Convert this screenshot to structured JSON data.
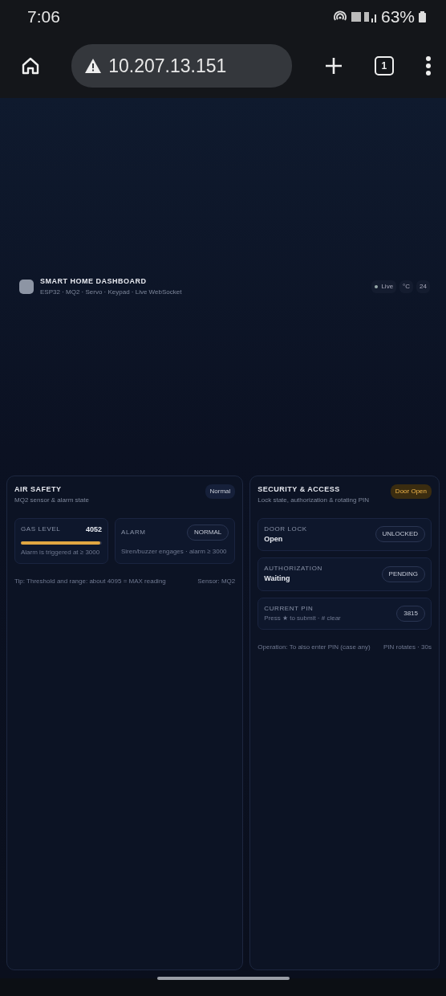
{
  "status_bar": {
    "time": "7:06",
    "battery": "63%"
  },
  "browser": {
    "url": "10.207.13.151",
    "tab_count": "1"
  },
  "header": {
    "title": "SMART HOME DASHBOARD",
    "subtitle": "ESP32 · MQ2 · Servo · Keypad · Live WebSocket",
    "live": "Live",
    "buttons": [
      "°C",
      "24"
    ]
  },
  "air_safety": {
    "title": "AIR SAFETY",
    "subtitle": "MQ2 sensor & alarm state",
    "badge": "Normal",
    "gas": {
      "label": "GAS LEVEL",
      "value": "4052",
      "level": 0.98,
      "hint": "Alarm is triggered at ≥ 3000"
    },
    "alarm": {
      "label": "ALARM",
      "value": "NORMAL",
      "hint": "Siren/buzzer engages · alarm ≥ 3000"
    },
    "footer": "Tip: Threshold and range: about 4095 = MAX reading",
    "footer_right": "Sensor: MQ2"
  },
  "security": {
    "title": "SECURITY & ACCESS",
    "subtitle": "Lock state, authorization & rotating PIN",
    "badge": "Door Open",
    "rows": [
      {
        "label": "DOOR LOCK",
        "value": "Open",
        "pill": "UNLOCKED"
      },
      {
        "label": "AUTHORIZATION",
        "value": "Waiting",
        "pill": "PENDING"
      },
      {
        "label": "CURRENT PIN",
        "value": "Press ★ to submit · # clear",
        "pill": "3815",
        "kind": "pin"
      }
    ],
    "footer": "Operation: To also enter PIN (case any)",
    "footer_right": "PIN rotates · 30s"
  }
}
